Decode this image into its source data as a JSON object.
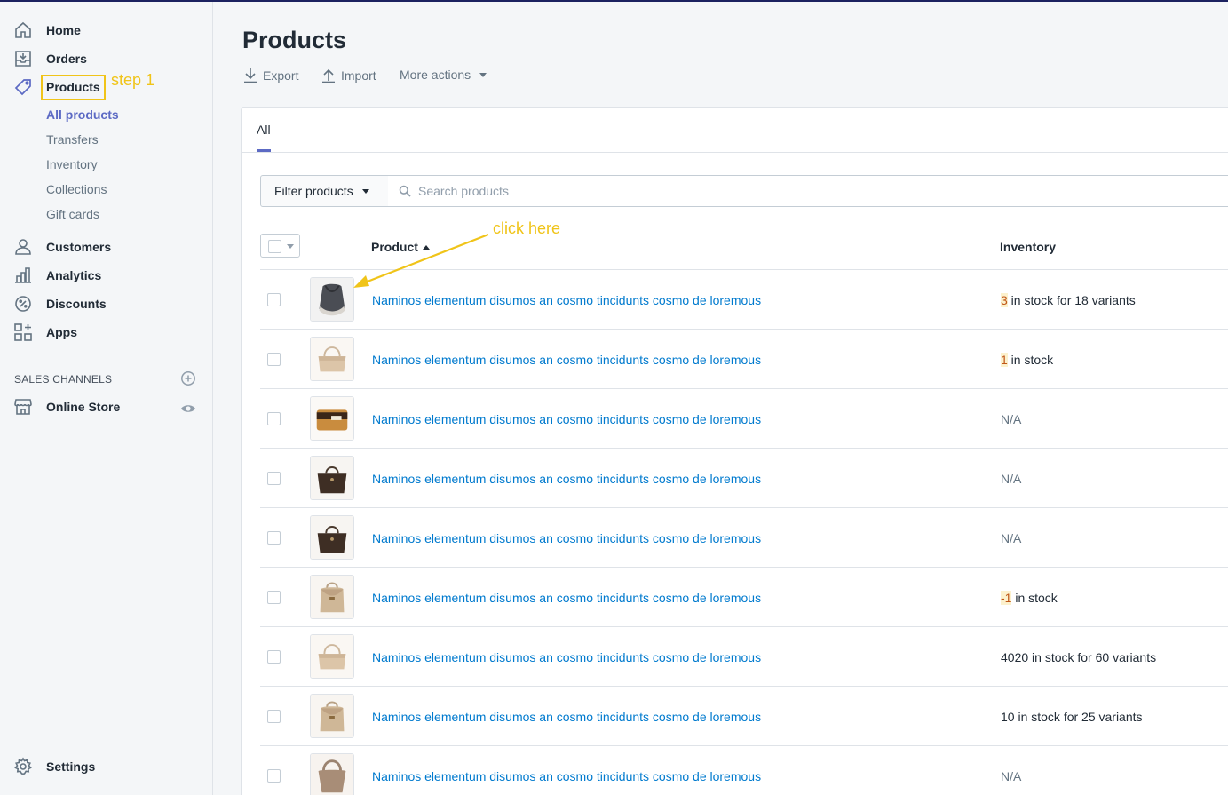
{
  "sidebar": {
    "items": [
      {
        "label": "Home",
        "icon": "home-icon"
      },
      {
        "label": "Orders",
        "icon": "orders-icon"
      },
      {
        "label": "Products",
        "icon": "tag-icon"
      },
      {
        "label": "Customers",
        "icon": "customer-icon"
      },
      {
        "label": "Analytics",
        "icon": "analytics-icon"
      },
      {
        "label": "Discounts",
        "icon": "discount-icon"
      },
      {
        "label": "Apps",
        "icon": "apps-icon"
      }
    ],
    "product_subitems": [
      "All products",
      "Transfers",
      "Inventory",
      "Collections",
      "Gift cards"
    ],
    "sales_channels_header": "SALES CHANNELS",
    "online_store": "Online Store",
    "settings": "Settings"
  },
  "annotations": {
    "step": "step 1",
    "click": "click here",
    "highlight_color": "#f0c419"
  },
  "header": {
    "title": "Products",
    "export": "Export",
    "import": "Import",
    "more_actions": "More actions"
  },
  "tabs": {
    "all": "All"
  },
  "filter": {
    "button": "Filter products",
    "search_placeholder": "Search products"
  },
  "table": {
    "columns": {
      "product": "Product",
      "inventory": "Inventory"
    },
    "rows": [
      {
        "name": "Naminos elementum disumos an cosmo tincidunts cosmo de loremous",
        "inv_num": "3",
        "inv_rest": " in stock for 18 variants",
        "thumb": "dark-hobo-bag"
      },
      {
        "name": "Naminos elementum disumos an cosmo tincidunts cosmo de loremous",
        "inv_num": "1",
        "inv_rest": " in stock",
        "thumb": "beige-shoulder-bag"
      },
      {
        "name": "Naminos elementum disumos an cosmo tincidunts cosmo de loremous",
        "inv_na": "N/A",
        "thumb": "tan-clutch"
      },
      {
        "name": "Naminos elementum disumos an cosmo tincidunts cosmo de loremous",
        "inv_na": "N/A",
        "thumb": "brown-tote"
      },
      {
        "name": "Naminos elementum disumos an cosmo tincidunts cosmo de loremous",
        "inv_na": "N/A",
        "thumb": "brown-tote"
      },
      {
        "name": "Naminos elementum disumos an cosmo tincidunts cosmo de loremous",
        "inv_num": "-1",
        "inv_rest": " in stock",
        "thumb": "beige-backpack"
      },
      {
        "name": "Naminos elementum disumos an cosmo tincidunts cosmo de loremous",
        "inv_text": "4020 in stock for 60 variants",
        "thumb": "beige-shoulder-bag"
      },
      {
        "name": "Naminos elementum disumos an cosmo tincidunts cosmo de loremous",
        "inv_text": "10 in stock for 25 variants",
        "thumb": "beige-backpack"
      },
      {
        "name": "Naminos elementum disumos an cosmo tincidunts cosmo de loremous",
        "inv_na": "N/A",
        "thumb": "taupe-hobo"
      }
    ]
  },
  "colors": {
    "link": "#007ace",
    "accent": "#5c6ac4",
    "stock_warning": "#c05717"
  }
}
